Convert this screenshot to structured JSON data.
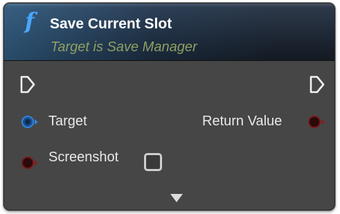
{
  "node": {
    "title": "Save Current Slot",
    "subtitle": "Target is Save Manager",
    "function_icon": "f"
  },
  "pins": {
    "exec_in": {
      "icon": "exec-in-pin"
    },
    "exec_out": {
      "icon": "exec-out-pin"
    },
    "target": {
      "label": "Target",
      "color": "#1f6fc4"
    },
    "return_value": {
      "label": "Return Value",
      "color": "#5a1010"
    },
    "screenshot": {
      "label": "Screenshot",
      "color": "#5a1010",
      "checked": false
    }
  },
  "colors": {
    "header_accent": "#4aa6ff",
    "subtitle": "#8f9f63",
    "node_body": "#464646"
  },
  "expand_icon": "triangle-down-icon"
}
